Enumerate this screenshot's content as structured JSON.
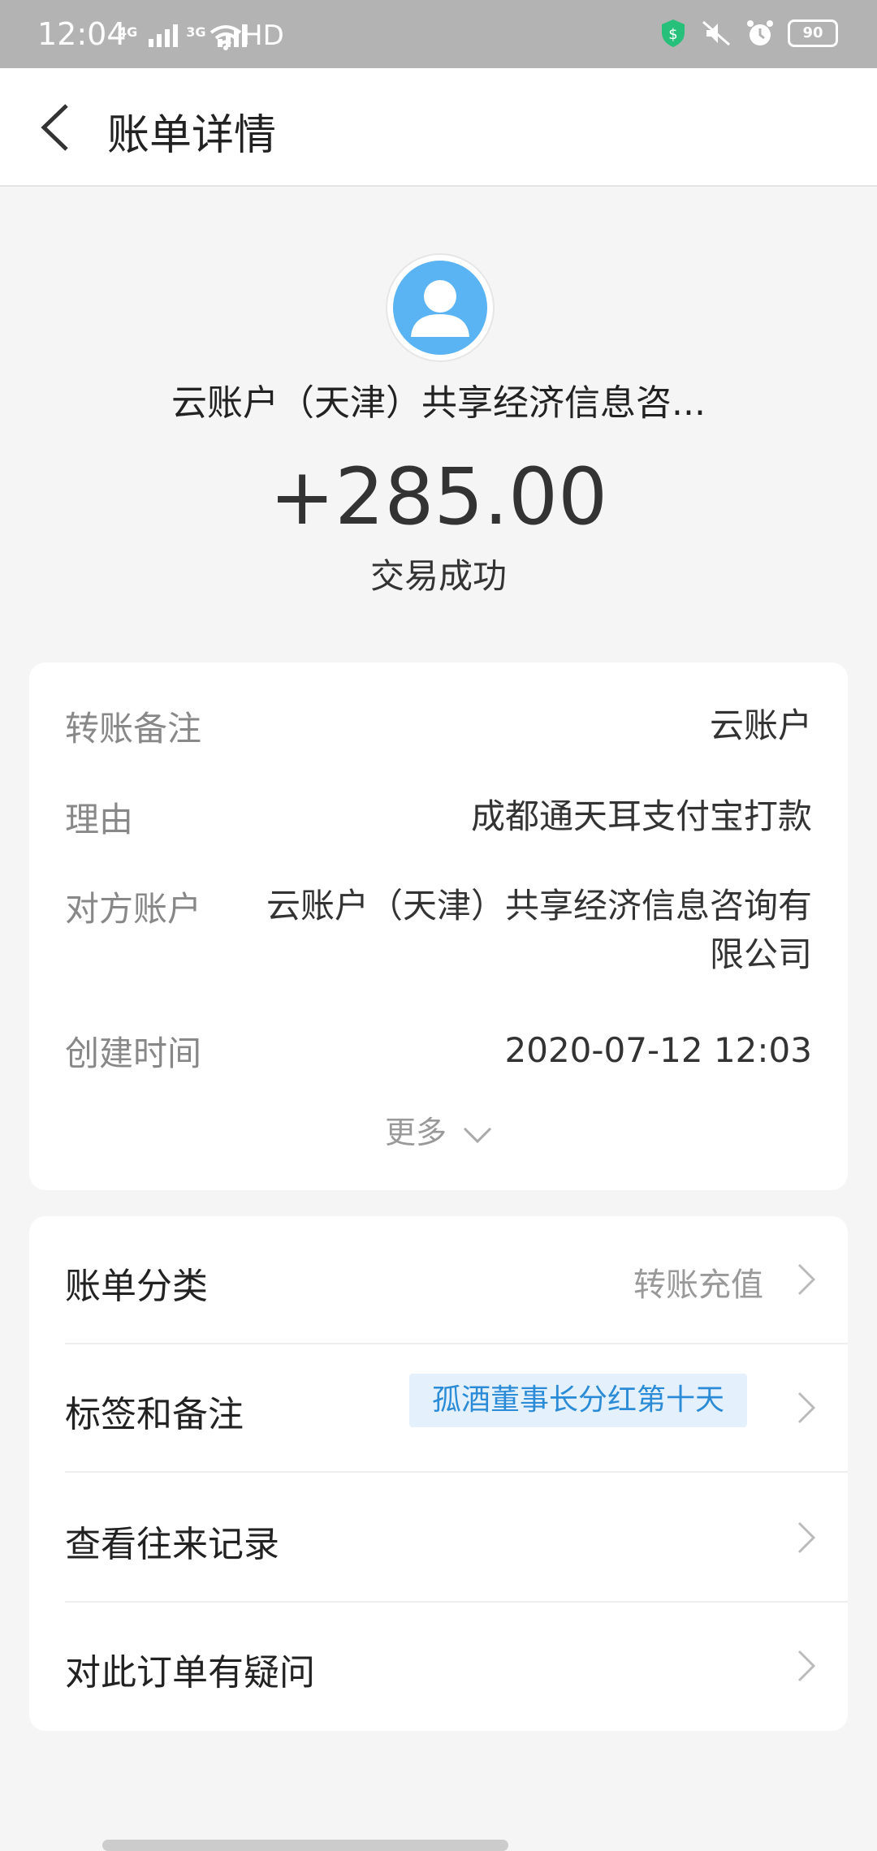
{
  "status_bar": {
    "time": "12:04",
    "network1": "4G",
    "network2": "3G",
    "hd": "HD",
    "battery": "90"
  },
  "header": {
    "title": "账单详情"
  },
  "summary": {
    "payee": "云账户（天津）共享经济信息咨...",
    "amount": "+285.00",
    "status": "交易成功"
  },
  "details": {
    "rows": [
      {
        "label": "转账备注",
        "value": "云账户"
      },
      {
        "label": "理由",
        "value": "成都通天耳支付宝打款"
      },
      {
        "label": "对方账户",
        "value": "云账户（天津）共享经济信息咨询有限公司"
      },
      {
        "label": "创建时间",
        "value": "2020-07-12 12:03"
      }
    ],
    "more_label": "更多"
  },
  "actions": {
    "items": [
      {
        "label": "账单分类",
        "extra": "转账充值"
      },
      {
        "label": "标签和备注",
        "tag": "孤酒董事长分红第十天"
      },
      {
        "label": "查看往来记录"
      },
      {
        "label": "对此订单有疑问"
      }
    ]
  },
  "colors": {
    "accent": "#2b8bd6",
    "avatar": "#5ab3f2",
    "tag_bg": "#e4f1fc"
  }
}
